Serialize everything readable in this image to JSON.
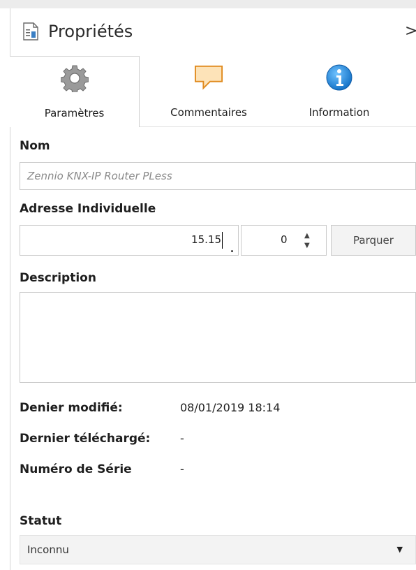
{
  "panel": {
    "title": "Propriétés",
    "close_glyph": ">"
  },
  "tabs": [
    {
      "label": "Paramètres",
      "icon": "gear-icon",
      "active": true
    },
    {
      "label": "Commentaires",
      "icon": "comment-icon",
      "active": false
    },
    {
      "label": "Information",
      "icon": "info-icon",
      "active": false
    }
  ],
  "form": {
    "name_label": "Nom",
    "name_placeholder": "Zennio KNX-IP Router PLess",
    "address_label": "Adresse Individuelle",
    "address_value": "15.15",
    "address_separator": ".",
    "address_device_value": "0",
    "park_button": "Parquer",
    "description_label": "Description",
    "description_value": ""
  },
  "info": {
    "modified_label": "Denier modifié:",
    "modified_value": "08/01/2019 18:14",
    "downloaded_label": "Dernier téléchargé:",
    "downloaded_value": "-",
    "serial_label": "Numéro de Série",
    "serial_value": "-"
  },
  "status": {
    "label": "Statut",
    "selected": "Inconnu"
  },
  "colors": {
    "info_icon": "#1a7fd4",
    "comment_icon": "#f7a23b",
    "gear_icon": "#8a8a8a"
  }
}
